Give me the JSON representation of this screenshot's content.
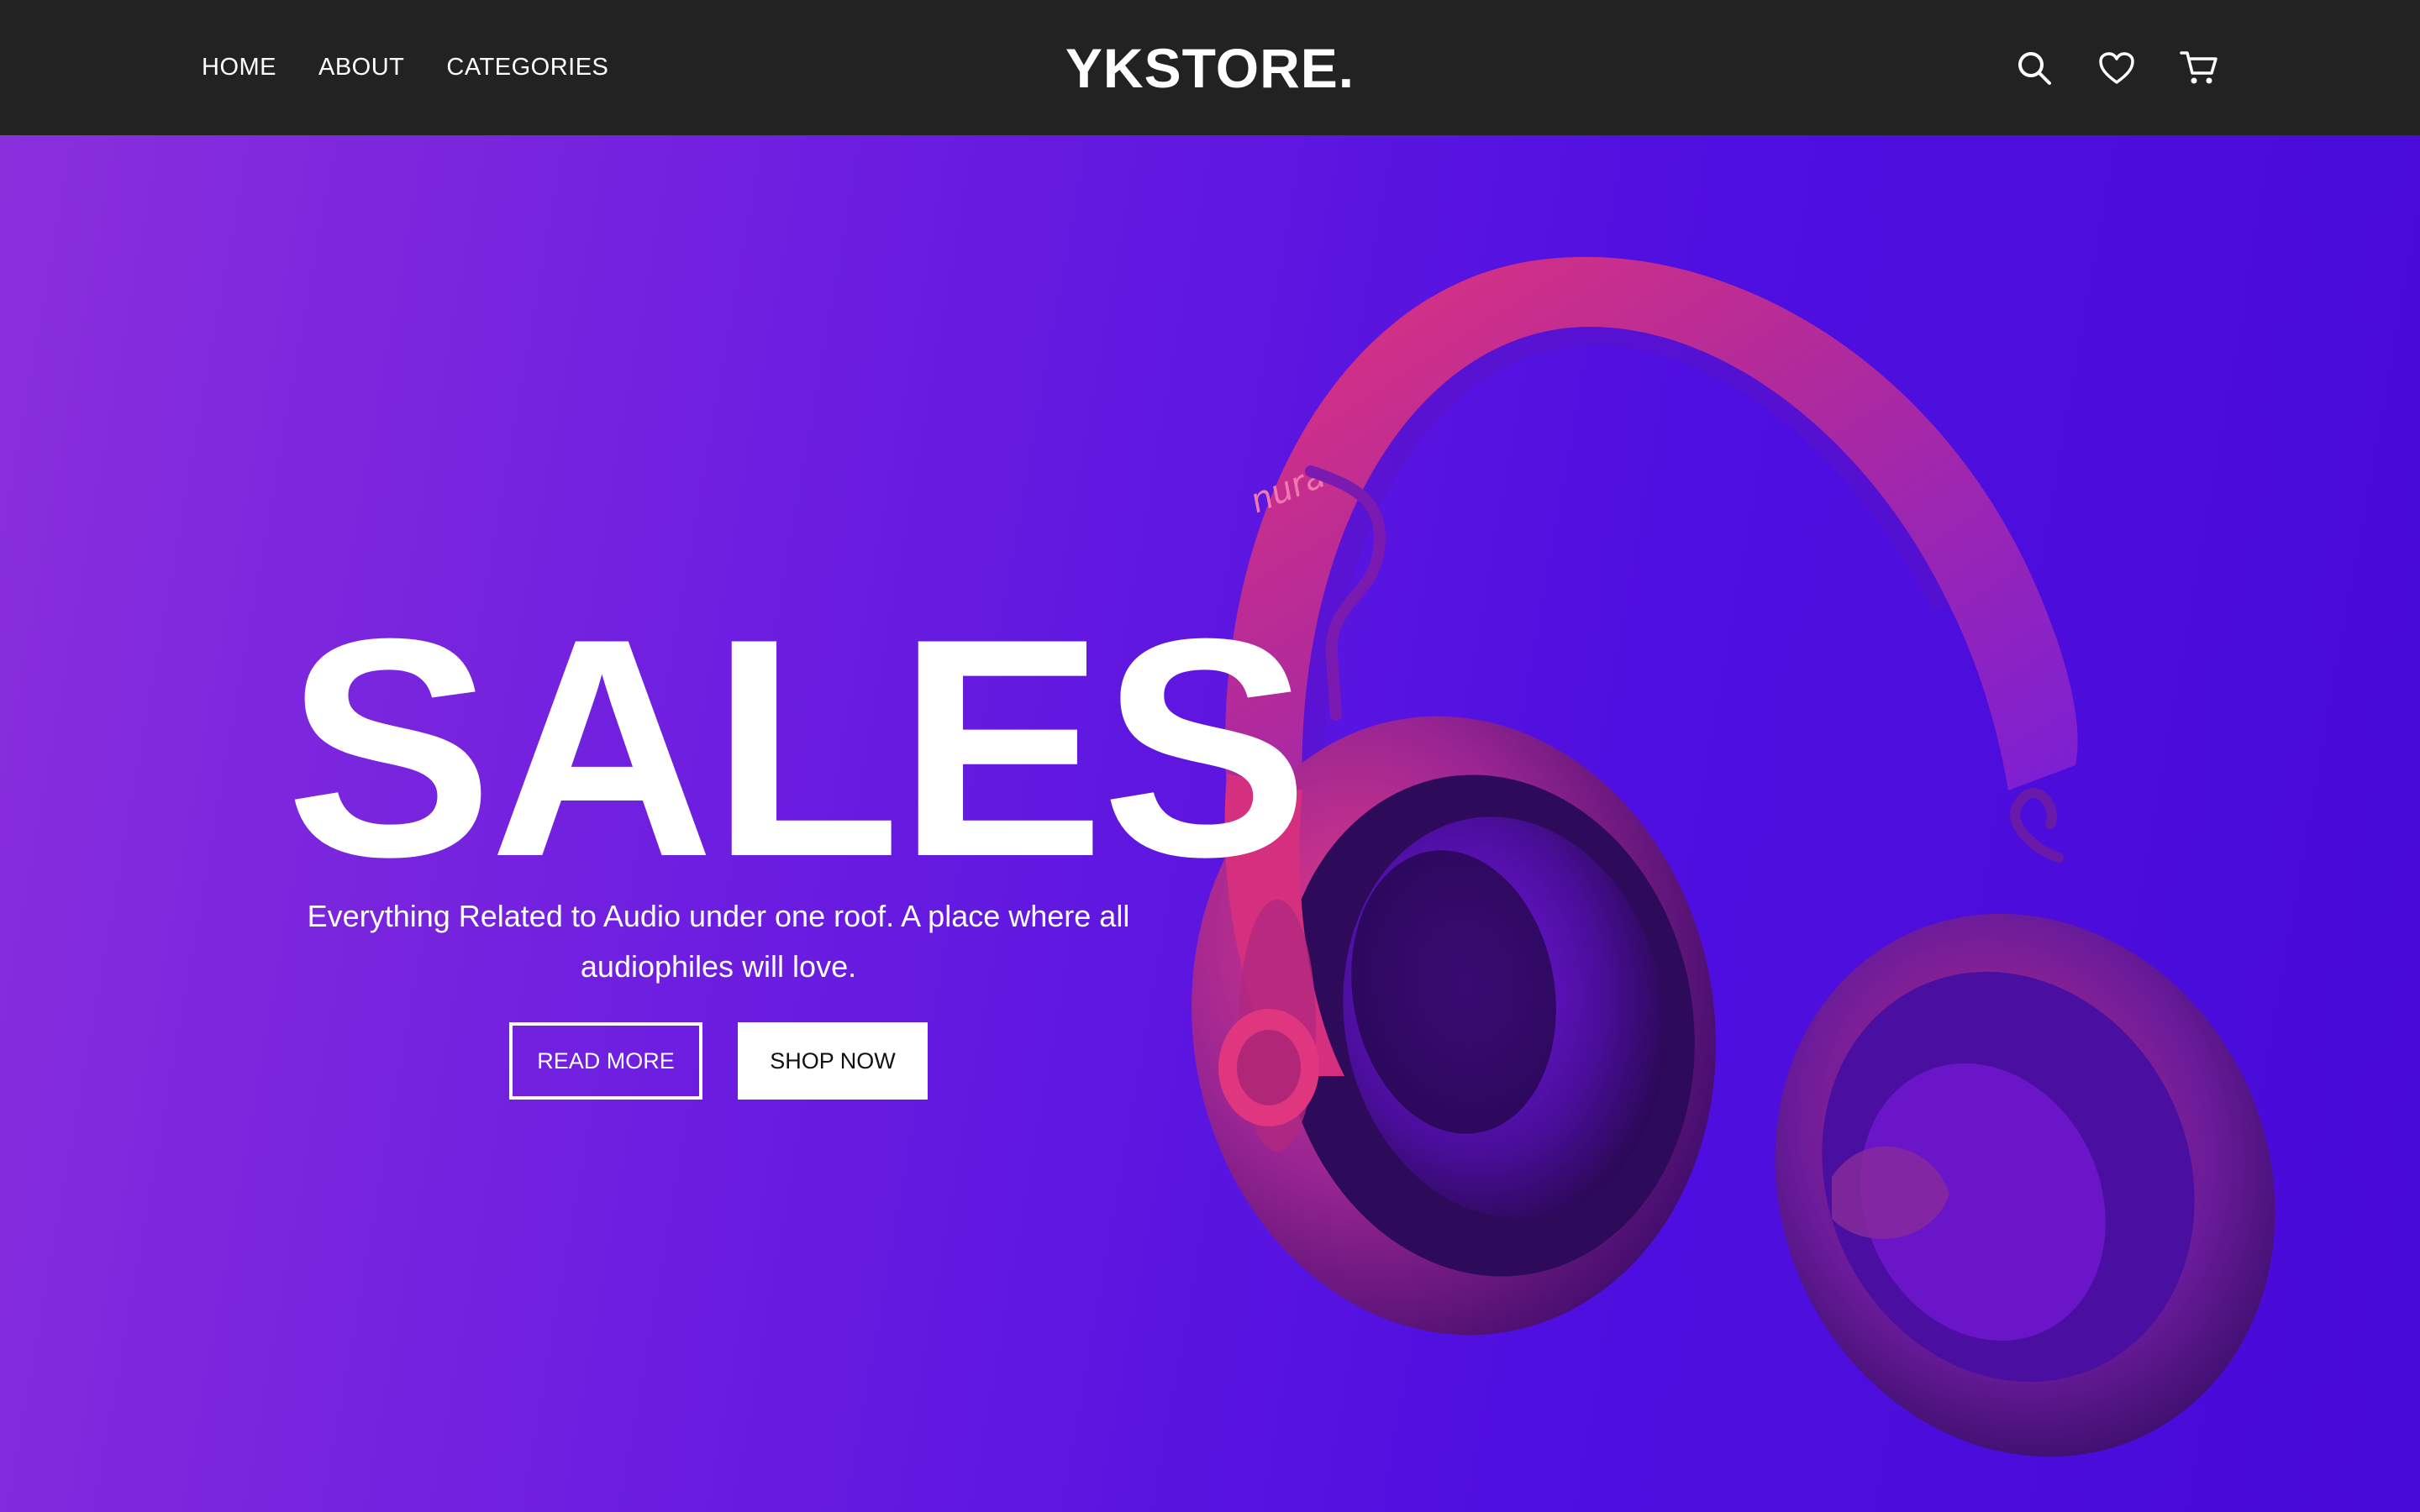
{
  "nav": {
    "links": [
      {
        "label": "HOME"
      },
      {
        "label": "ABOUT"
      },
      {
        "label": "CATEGORIES"
      }
    ],
    "brand": "YKSTORE.",
    "icons": [
      "search-icon",
      "heart-icon",
      "cart-icon"
    ]
  },
  "hero": {
    "title": "SALES",
    "subtitle": "Everything Related to Audio under one roof. A place where all audiophiles will love.",
    "buttons": {
      "read_more": "READ MORE",
      "shop_now": "SHOP NOW"
    },
    "product_brand_text": "nura",
    "colors": {
      "gradient_left": "#8a2fdc",
      "gradient_right": "#480ad8",
      "headphone_pink": "#e0307a",
      "navbar": "#222222"
    }
  }
}
